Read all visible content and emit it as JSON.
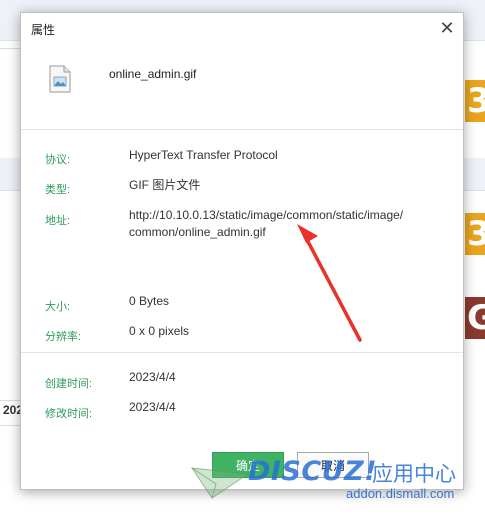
{
  "background": {
    "side_tiles": [
      {
        "char": "3",
        "color": "#e9a51d"
      },
      {
        "char": "3",
        "color": "#e9a51d"
      },
      {
        "char": "G",
        "color": "#8a3a2c"
      }
    ],
    "year_fragment": "202"
  },
  "dialog": {
    "title": "属性",
    "close_glyph": "✕",
    "filename": "online_admin.gif",
    "rows": {
      "protocol": {
        "label": "协议:",
        "value": "HyperText Transfer Protocol"
      },
      "type": {
        "label": "类型:",
        "value": "GIF 图片文件"
      },
      "address": {
        "label": "地址:",
        "value_line1": "http://10.10.0.13/static/image/common/static/image/",
        "value_line2": "common/online_admin.gif"
      },
      "size": {
        "label": "大小:",
        "value": "0 Bytes"
      },
      "resolution": {
        "label": "分辨率:",
        "value": "0 x 0 pixels"
      },
      "created": {
        "label": "创建时间:",
        "value": "2023/4/4"
      },
      "modified": {
        "label": "修改时间:",
        "value": "2023/4/4"
      }
    },
    "buttons": {
      "ok": "确定",
      "cancel": "取消"
    }
  },
  "watermark": {
    "brand": "DISCUZ!",
    "sub": "应用中心",
    "url": "addon.dismall.com"
  },
  "colors": {
    "label_green": "#2f9c5a",
    "ok_button": "#3fb364",
    "annotation_arrow": "#e8322b"
  }
}
